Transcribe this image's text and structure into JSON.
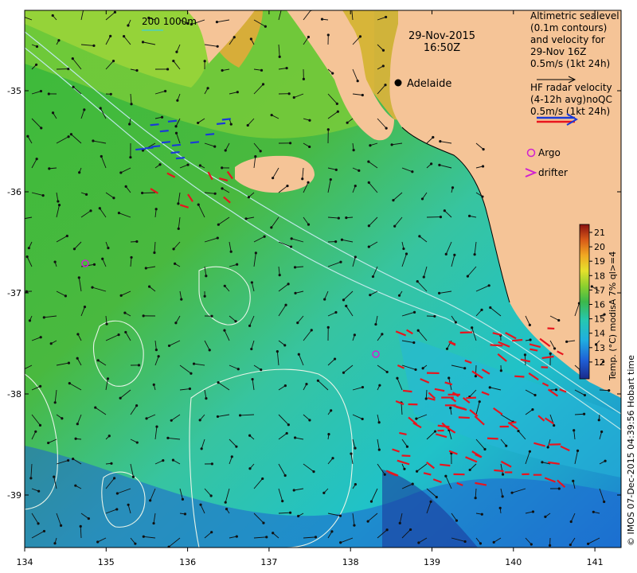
{
  "header": {
    "date": "29-Nov-2015",
    "time": "16:50Z"
  },
  "bathymetry_label": "200  1000m",
  "legend": {
    "altimetric": [
      "Altimetric sealevel",
      "(0.1m contours)",
      "and velocity for",
      "29-Nov 16Z",
      "0.5m/s (1kt 24h)"
    ],
    "hf_radar": [
      "HF radar velocity",
      "(4-12h avg)noQC",
      "0.5m/s (1kt 24h)"
    ],
    "argo": "Argo",
    "drifter": "drifter"
  },
  "place": {
    "name": "Adelaide"
  },
  "colorbar": {
    "ticks": [
      "21",
      "20",
      "19",
      "18",
      "17",
      "16",
      "15",
      "14",
      "13",
      "12"
    ],
    "label": "Temp. (°C) modisA 7% ql>=4"
  },
  "x_axis": {
    "ticks": [
      "134",
      "135",
      "136",
      "137",
      "138",
      "139",
      "140",
      "141"
    ]
  },
  "y_axis": {
    "ticks": [
      "-35",
      "-36",
      "-37",
      "-38",
      "-39"
    ]
  },
  "footer": "© IMOS 07-Dec-2015 04:39:56 Hobart time",
  "colors": {
    "land": "#f5c497",
    "hf": "#e8141e",
    "hf_blue": "#1a3ad8",
    "argo": "#d020d0",
    "contour": "#e8f4e8"
  }
}
